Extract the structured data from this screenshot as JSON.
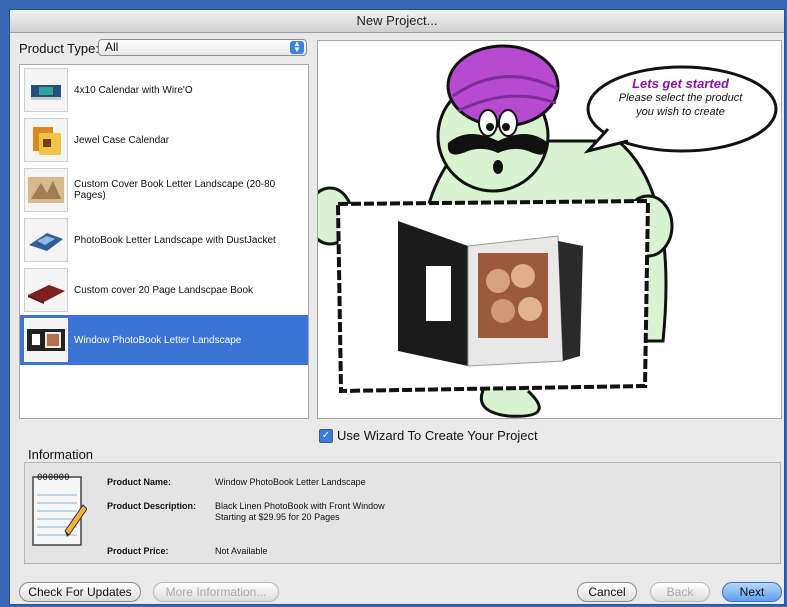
{
  "window": {
    "title": "New Project..."
  },
  "product_type": {
    "label": "Product Type:",
    "selected": "All"
  },
  "products": [
    {
      "label": "4x10 Calendar with Wire'O",
      "selected": false
    },
    {
      "label": "Jewel Case Calendar",
      "selected": false
    },
    {
      "label": "Custom Cover Book Letter Landscape (20-80 Pages)",
      "selected": false
    },
    {
      "label": "PhotoBook Letter Landscape with  DustJacket",
      "selected": false
    },
    {
      "label": "Custom cover 20 Page Landscpae Book",
      "selected": false
    },
    {
      "label": "Window PhotoBook Letter Landscape",
      "selected": true
    }
  ],
  "bubble": {
    "title": "Lets get started",
    "line1": "Please select the product",
    "line2": "you wish to create"
  },
  "wizard": {
    "label": "Use Wizard To Create Your Project",
    "checked": true
  },
  "information": {
    "heading": "Information",
    "name_label": "Product Name:",
    "name_value": "Window PhotoBook Letter Landscape",
    "desc_label": "Product Description:",
    "desc_line1": "Black Linen PhotoBook with Front Window",
    "desc_line2": "Starting at $29.95 for 20 Pages",
    "price_label": "Product Price:",
    "price_value": "Not Available",
    "notepad_header": "000000"
  },
  "buttons": {
    "check_updates": "Check For Updates",
    "more_info": "More Information...",
    "cancel": "Cancel",
    "back": "Back",
    "next": "Next"
  },
  "colors": {
    "selection": "#3a73d4",
    "genie_skin": "#d8f3cf",
    "turban": "#b64bd1",
    "bubble_title": "#8a12a3"
  }
}
